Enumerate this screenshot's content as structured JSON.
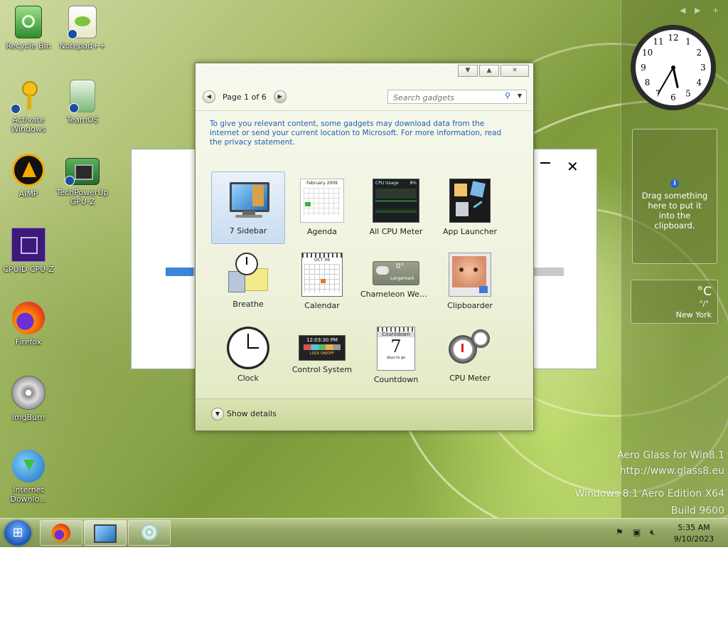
{
  "desktop_icons": [
    {
      "label": "Recycle Bin",
      "icon": "recycle-bin-icon"
    },
    {
      "label": "Notepad++",
      "icon": "notepad-plus-plus-icon"
    },
    {
      "label": "Activate Windows",
      "icon": "key-icon"
    },
    {
      "label": "TeamOS",
      "icon": "folder-icon"
    },
    {
      "label": "AIMP",
      "icon": "aimp-icon"
    },
    {
      "label": "TechPowerUp GPU-Z",
      "icon": "gpu-z-icon"
    },
    {
      "label": "CPUID CPU-Z",
      "icon": "cpu-z-icon"
    },
    {
      "label": "Firefox",
      "icon": "firefox-icon"
    },
    {
      "label": "ImgBurn",
      "icon": "imgburn-icon"
    },
    {
      "label": "Internet Downlo...",
      "icon": "internet-download-manager-icon"
    }
  ],
  "background_dialog": {
    "progress_fraction": 0.07
  },
  "gallery": {
    "page_text": "Page 1 of 6",
    "search_placeholder": "Search gadgets",
    "notice": "To give you relevant content, some gadgets may download data from the internet or send your current location to Microsoft. For more information, read the privacy statement.",
    "gadgets": [
      {
        "label": "7 Sidebar",
        "icon": "monitor-icon",
        "selected": true
      },
      {
        "label": "Agenda",
        "icon": "agenda-calendar-icon",
        "selected": false
      },
      {
        "label": "All CPU Meter",
        "icon": "cpu-usage-meter-icon",
        "selected": false
      },
      {
        "label": "App Launcher",
        "icon": "app-launcher-icon",
        "selected": false
      },
      {
        "label": "Breathe",
        "icon": "alarm-clock-icon",
        "selected": false
      },
      {
        "label": "Calendar",
        "icon": "calendar-icon",
        "selected": false
      },
      {
        "label": "Chameleon Weat...",
        "icon": "weather-cloud-icon",
        "selected": false
      },
      {
        "label": "Clipboarder",
        "icon": "baby-photo-icon",
        "selected": false
      },
      {
        "label": "Clock",
        "icon": "clock-icon",
        "selected": false
      },
      {
        "label": "Control System",
        "icon": "control-system-icon",
        "selected": false
      },
      {
        "label": "Countdown",
        "icon": "countdown-calendar-icon",
        "selected": false
      },
      {
        "label": "CPU Meter",
        "icon": "speedometer-icon",
        "selected": false
      }
    ],
    "thumb_text": {
      "agenda_title": "February 2009",
      "cpu_title": "CPU Usage",
      "cpu_percent": "8%",
      "calendar_month": "OCT 06",
      "chameleon_temp": "0°",
      "chameleon_city": "Langemark",
      "control_time": "12:03:30 PM",
      "control_lock": "LOCK ON/OFF",
      "countdown_title": "Countdown",
      "countdown_days": "7",
      "countdown_sub": "days to go"
    },
    "show_details": "Show details"
  },
  "sidebar": {
    "clock_time": {
      "hour": 5,
      "minute": 35
    },
    "clock_numbers": [
      "12",
      "1",
      "2",
      "3",
      "4",
      "5",
      "6",
      "7",
      "8",
      "9",
      "10",
      "11"
    ],
    "clipboard_text": "Drag something here to put it into the clipboard.",
    "weather": {
      "degree": "°C",
      "range": "°/°",
      "city": "New York"
    }
  },
  "watermark": {
    "line1": "Aero Glass for Win8.1",
    "line2": "http://www.glass8.eu",
    "line3": "Windows 8.1 Aero Edition X64",
    "line4": "Build 9600"
  },
  "taskbar": {
    "time": "5:35 AM",
    "date": "9/10/2023",
    "pinned": [
      {
        "icon": "firefox-icon"
      },
      {
        "icon": "gadget-gallery-icon"
      },
      {
        "icon": "cd-setup-icon"
      }
    ]
  },
  "colors": {
    "accent_blue": "#1f5fb4",
    "wallpaper_green": "#8fae48"
  }
}
